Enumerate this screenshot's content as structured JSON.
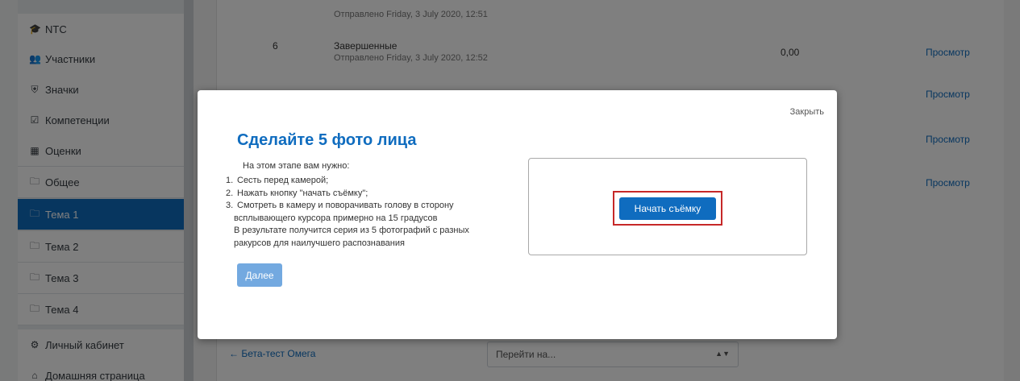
{
  "sidebar": {
    "items": [
      {
        "icon": "graduation-cap-icon",
        "glyph": "🎓",
        "label": "NTC"
      },
      {
        "icon": "users-icon",
        "glyph": "👥",
        "label": "Участники"
      },
      {
        "icon": "shield-icon",
        "glyph": "⛨",
        "label": "Значки"
      },
      {
        "icon": "check-square-icon",
        "glyph": "☑",
        "label": "Компетенции"
      },
      {
        "icon": "table-icon",
        "glyph": "▦",
        "label": "Оценки"
      },
      {
        "icon": "folder-icon",
        "glyph": "🗀",
        "label": "Общее"
      },
      {
        "icon": "folder-icon",
        "glyph": "🗀",
        "label": "Тема 1",
        "active": true
      },
      {
        "icon": "folder-icon",
        "glyph": "🗀",
        "label": "Тема 2"
      },
      {
        "icon": "folder-icon",
        "glyph": "🗀",
        "label": "Тема 3"
      },
      {
        "icon": "folder-icon",
        "glyph": "🗀",
        "label": "Тема 4"
      },
      {
        "icon": "dashboard-icon",
        "glyph": "⚙",
        "label": "Личный кабинет"
      },
      {
        "icon": "home-icon",
        "glyph": "⌂",
        "label": "Домашняя страница"
      }
    ]
  },
  "background": {
    "rows": [
      {
        "num": "",
        "status": "",
        "sub": "Отправлено Friday, 3 July 2020, 12:51",
        "grade": "",
        "link": ""
      },
      {
        "num": "6",
        "status": "Завершенные",
        "sub": "Отправлено Friday, 3 July 2020, 12:52",
        "grade": "0,00",
        "link": "Просмотр"
      },
      {
        "num": "",
        "status": "",
        "sub": "",
        "grade": "",
        "link": "Просмотр"
      },
      {
        "num": "",
        "status": "",
        "sub": "",
        "grade": "",
        "link": "Просмотр"
      },
      {
        "num": "",
        "status": "",
        "sub": "",
        "grade": "",
        "link": "Просмотр"
      }
    ],
    "bottom_link": "← Бета-тест Омега",
    "jump_select": "Перейти на..."
  },
  "modal": {
    "close_label": "Закрыть",
    "title": "Сделайте 5 фото лица",
    "intro": "На этом этапе вам нужно:",
    "steps": [
      {
        "n": "1.",
        "text": "Сесть перед камерой;"
      },
      {
        "n": "2.",
        "text": "Нажать кнопку \"начать съёмку\";"
      },
      {
        "n": "3.",
        "text": "Смотреть в камеру и поворачивать голову в сторону"
      }
    ],
    "step3_cont1": "всплывающего курсора примерно на 15 градусов",
    "result_line1": "В результате получится серия из 5 фотографий с разных",
    "result_line2": "ракурсов для наилучшего распознавания",
    "next_label": "Далее",
    "start_label": "Начать съёмку"
  },
  "colors": {
    "accent": "#0f6cbf",
    "highlight": "#c62828"
  }
}
